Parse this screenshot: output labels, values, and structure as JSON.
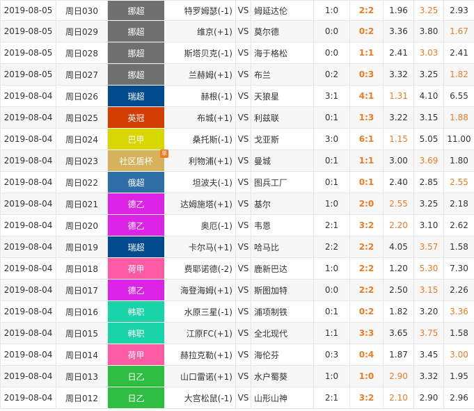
{
  "matches": [
    {
      "date": "2019-08-05",
      "code": "周日030",
      "league": "挪超",
      "league_color": "#707070",
      "home": "特罗姆瑟(-1)",
      "vs": "VS",
      "away": "姆延达伦",
      "half": "1:0",
      "full": "2:2",
      "odds": [
        "1.96",
        "3.25",
        "2.93"
      ],
      "hit": 1
    },
    {
      "date": "2019-08-05",
      "code": "周日029",
      "league": "挪超",
      "league_color": "#707070",
      "home": "维京(+1)",
      "vs": "VS",
      "away": "莫尔德",
      "half": "0:0",
      "full": "0:2",
      "odds": [
        "3.36",
        "3.80",
        "1.67"
      ],
      "hit": 2
    },
    {
      "date": "2019-08-05",
      "code": "周日028",
      "league": "挪超",
      "league_color": "#707070",
      "home": "斯塔贝克(-1)",
      "vs": "VS",
      "away": "海于格松",
      "half": "0:0",
      "full": "1:1",
      "odds": [
        "2.41",
        "3.03",
        "2.41"
      ],
      "hit": 1
    },
    {
      "date": "2019-08-05",
      "code": "周日027",
      "league": "挪超",
      "league_color": "#707070",
      "home": "兰赫姆(+1)",
      "vs": "VS",
      "away": "布兰",
      "half": "0:2",
      "full": "0:3",
      "odds": [
        "3.32",
        "3.25",
        "1.82"
      ],
      "hit": 2
    },
    {
      "date": "2019-08-04",
      "code": "周日026",
      "league": "瑞超",
      "league_color": "#004b8d",
      "home": "赫根(-1)",
      "vs": "VS",
      "away": "天狼星",
      "half": "3:1",
      "full": "4:1",
      "odds": [
        "1.31",
        "4.10",
        "6.55"
      ],
      "hit": 0
    },
    {
      "date": "2019-08-04",
      "code": "周日025",
      "league": "英冠",
      "league_color": "#d33e00",
      "home": "布城(+1)",
      "vs": "VS",
      "away": "利兹联",
      "half": "0:1",
      "full": "1:3",
      "odds": [
        "3.22",
        "3.15",
        "1.88"
      ],
      "hit": 2
    },
    {
      "date": "2019-08-04",
      "code": "周日024",
      "league": "巴甲",
      "league_color": "#d8d800",
      "home": "桑托斯(-1)",
      "vs": "VS",
      "away": "戈亚斯",
      "half": "3:0",
      "full": "6:1",
      "odds": [
        "1.15",
        "5.05",
        "11.00"
      ],
      "hit": 0
    },
    {
      "date": "2019-08-04",
      "code": "周日023",
      "league": "社区盾杯",
      "league_color": "#d7b25c",
      "badge": "单",
      "home": "利物浦(+1)",
      "vs": "VS",
      "away": "曼城",
      "half": "0:1",
      "full": "1:1",
      "odds": [
        "3.00",
        "3.69",
        "1.80"
      ],
      "hit": 1
    },
    {
      "date": "2019-08-04",
      "code": "周日022",
      "league": "俄超",
      "league_color": "#2e6fa7",
      "home": "坦波夫(-1)",
      "vs": "VS",
      "away": "图兵工厂",
      "half": "0:1",
      "full": "0:1",
      "odds": [
        "2.40",
        "2.85",
        "2.55"
      ],
      "hit": 2
    },
    {
      "date": "2019-08-04",
      "code": "周日021",
      "league": "德乙",
      "league_color": "#db24e6",
      "home": "达姆施塔(+1)",
      "vs": "VS",
      "away": "基尔",
      "half": "1:0",
      "full": "2:0",
      "odds": [
        "2.55",
        "3.25",
        "2.18"
      ],
      "hit": 0
    },
    {
      "date": "2019-08-04",
      "code": "周日020",
      "league": "德乙",
      "league_color": "#db24e6",
      "home": "奥厄(-1)",
      "vs": "VS",
      "away": "韦恩",
      "half": "2:1",
      "full": "3:2",
      "odds": [
        "2.20",
        "3.10",
        "2.62"
      ],
      "hit": 0
    },
    {
      "date": "2019-08-04",
      "code": "周日019",
      "league": "瑞超",
      "league_color": "#004b8d",
      "home": "卡尔马(+1)",
      "vs": "VS",
      "away": "哈马比",
      "half": "2:2",
      "full": "2:2",
      "odds": [
        "4.05",
        "3.57",
        "1.58"
      ],
      "hit": 1
    },
    {
      "date": "2019-08-04",
      "code": "周日018",
      "league": "荷甲",
      "league_color": "#fc5aa3",
      "home": "费耶诺德(-2)",
      "vs": "VS",
      "away": "鹿新巴达",
      "half": "1:0",
      "full": "2:2",
      "odds": [
        "1.20",
        "5.30",
        "7.30"
      ],
      "hit": 1
    },
    {
      "date": "2019-08-04",
      "code": "周日017",
      "league": "德乙",
      "league_color": "#db24e6",
      "home": "海登海姆(+1)",
      "vs": "VS",
      "away": "斯图加特",
      "half": "0:0",
      "full": "2:2",
      "odds": [
        "2.50",
        "3.15",
        "2.26"
      ],
      "hit": 1
    },
    {
      "date": "2019-08-04",
      "code": "周日016",
      "league": "韩职",
      "league_color": "#18d4a8",
      "home": "水原三星(-1)",
      "vs": "VS",
      "away": "浦项制铁",
      "half": "0:1",
      "full": "0:2",
      "odds": [
        "1.82",
        "3.20",
        "3.36"
      ],
      "hit": 2
    },
    {
      "date": "2019-08-04",
      "code": "周日015",
      "league": "韩职",
      "league_color": "#18d4a8",
      "home": "江原FC(+1)",
      "vs": "VS",
      "away": "全北现代",
      "half": "1:1",
      "full": "3:3",
      "odds": [
        "3.65",
        "3.75",
        "1.58"
      ],
      "hit": 1
    },
    {
      "date": "2019-08-04",
      "code": "周日014",
      "league": "荷甲",
      "league_color": "#fc5aa3",
      "home": "赫拉克勒(+1)",
      "vs": "VS",
      "away": "海伦芬",
      "half": "0:3",
      "full": "0:4",
      "odds": [
        "1.87",
        "3.45",
        "3.00"
      ],
      "hit": 2
    },
    {
      "date": "2019-08-04",
      "code": "周日013",
      "league": "日乙",
      "league_color": "#2fbd42",
      "home": "山口雷诺(+1)",
      "vs": "VS",
      "away": "水户蜀葵",
      "half": "1:0",
      "full": "1:0",
      "odds": [
        "2.90",
        "3.32",
        "1.95"
      ],
      "hit": 0
    },
    {
      "date": "2019-08-04",
      "code": "周日012",
      "league": "日乙",
      "league_color": "#2fbd42",
      "home": "大宫松鼠(-1)",
      "vs": "VS",
      "away": "山形山神",
      "half": "2:1",
      "full": "3:2",
      "odds": [
        "2.10",
        "2.90",
        "2.96"
      ],
      "hit": 0
    }
  ]
}
